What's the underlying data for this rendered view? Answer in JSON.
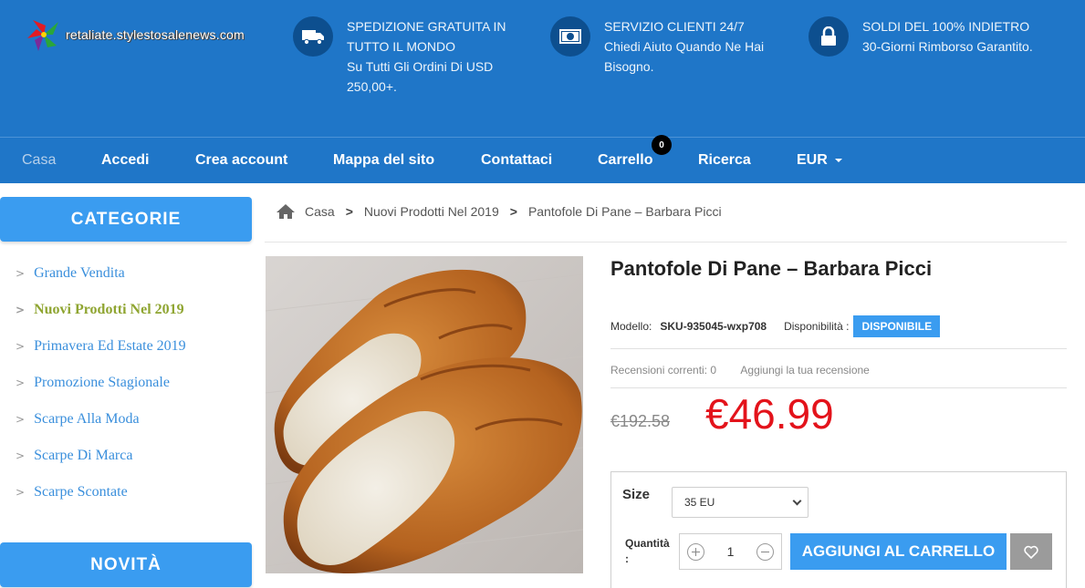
{
  "header": {
    "logo_text": "retaliate.stylestosalenews.com",
    "features": [
      {
        "icon": "truck-icon",
        "title": "SPEDIZIONE GRATUITA IN TUTTO IL MONDO",
        "text": "Su Tutti Gli Ordini Di USD 250,00+."
      },
      {
        "icon": "money-icon",
        "title": "SERVIZIO CLIENTI 24/7",
        "text": "Chiedi Aiuto Quando Ne Hai Bisogno."
      },
      {
        "icon": "lock-icon",
        "title": "SOLDI DEL 100% INDIETRO",
        "text": "30-Giorni Rimborso Garantito."
      }
    ]
  },
  "nav": {
    "items": [
      "Casa",
      "Accedi",
      "Crea account",
      "Mappa del sito",
      "Contattaci",
      "Carrello",
      "Ricerca",
      "EUR"
    ],
    "cart_count": "0"
  },
  "sidebar": {
    "categories_title": "CATEGORIE",
    "categories": [
      "Grande Vendita",
      "Nuovi Prodotti Nel 2019",
      "Primavera Ed Estate 2019",
      "Promozione Stagionale",
      "Scarpe Alla Moda",
      "Scarpe Di Marca",
      "Scarpe Scontate"
    ],
    "new_title": "NOVITÀ"
  },
  "breadcrumb": [
    "Casa",
    "Nuovi Prodotti Nel 2019",
    "Pantofole Di Pane – Barbara Picci"
  ],
  "product": {
    "title": "Pantofole Di Pane – Barbara Picci",
    "model_label": "Modello:",
    "model_value": "SKU-935045-wxp708",
    "availability_label": "Disponibilità :",
    "availability_value": "DISPONIBILE",
    "reviews_label": "Recensioni correnti: 0",
    "add_review": "Aggiungi la tua recensione",
    "old_price": "€192.58",
    "new_price": "€46.99",
    "size_label": "Size",
    "size_value": "35 EU",
    "qty_label_1": "Quantità",
    "qty_label_2": ":",
    "qty_value": "1",
    "add_to_cart": "AGGIUNGI AL CARRELLO"
  },
  "colors": {
    "brand_blue": "#1f76c8",
    "accent_blue": "#3a9cf0",
    "price_red": "#e3131b",
    "active_category": "#8fa531"
  }
}
